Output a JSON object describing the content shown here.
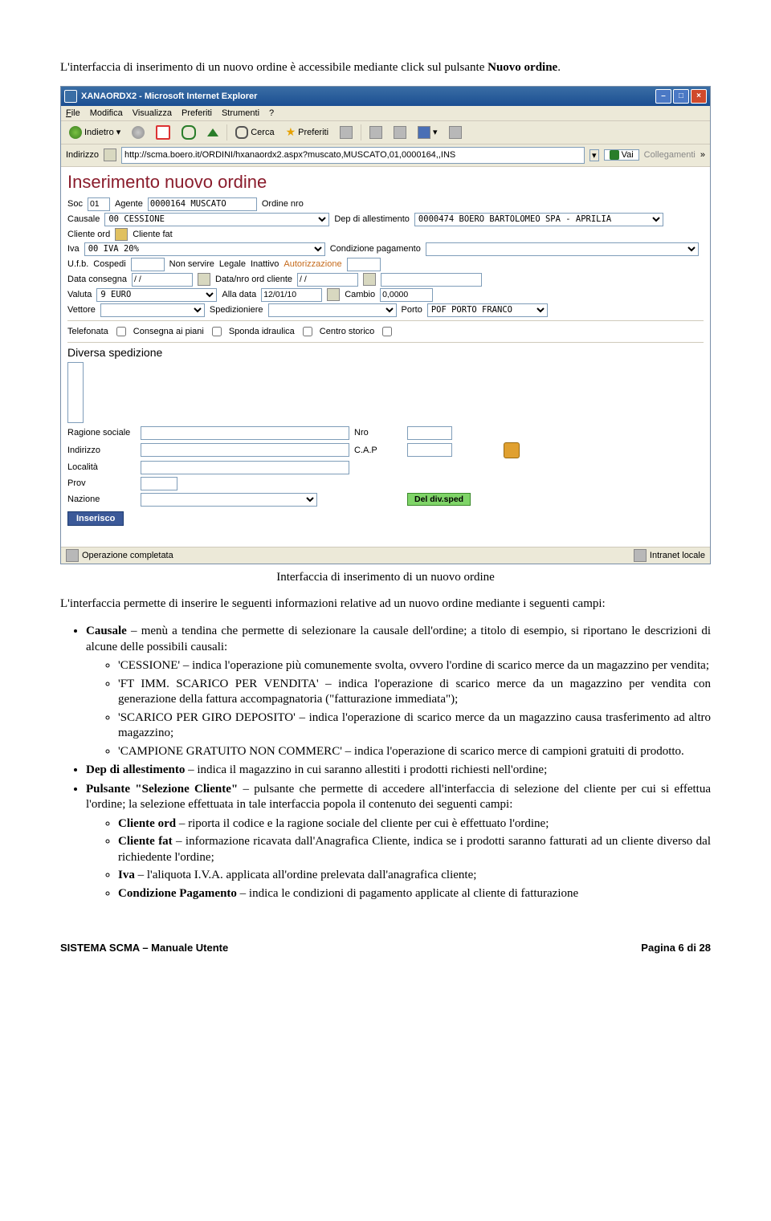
{
  "intro_prefix": "L'interfaccia di inserimento di un nuovo ordine è accessibile mediante click sul pulsante ",
  "intro_bold": "Nuovo ordine",
  "window": {
    "title": "XANAORDX2 - Microsoft Internet Explorer",
    "menu": {
      "file": "File",
      "mod": "Modifica",
      "vis": "Visualizza",
      "pref": "Preferiti",
      "str": "Strumenti",
      "help": "?"
    },
    "toolbar": {
      "back": "Indietro",
      "search": "Cerca",
      "fav": "Preferiti"
    },
    "addr_label": "Indirizzo",
    "addr_value": "http://scma.boero.it/ORDINI/hxanaordx2.aspx?muscato,MUSCATO,01,0000164,,INS",
    "go": "Vai",
    "links": "Collegamenti",
    "status_left": "Operazione completata",
    "status_right": "Intranet locale"
  },
  "form": {
    "title": "Inserimento nuovo ordine",
    "soc_l": "Soc",
    "soc_v": "01",
    "agente_l": "Agente",
    "agente_v": "0000164 MUSCATO",
    "ordine_l": "Ordine nro",
    "causale_l": "Causale",
    "causale_v": "00 CESSIONE",
    "dep_l": "Dep di allestimento",
    "dep_v": "0000474 BOERO BARTOLOMEO SPA - APRILIA",
    "cliord_l": "Cliente ord",
    "clifat_l": "Cliente fat",
    "iva_l": "Iva",
    "iva_v": "00 IVA 20%",
    "condpag_l": "Condizione pagamento",
    "ufb_l": "U.f.b.",
    "cosp_l": "Cospedi",
    "nonserv_l": "Non servire",
    "legale_l": "Legale",
    "inatt_l": "Inattivo",
    "auth_l": "Autorizzazione",
    "datacons_l": "Data consegna",
    "datacons_v": "/ /",
    "dataord_l": "Data/nro ord cliente",
    "dataord_v": "/ /",
    "valuta_l": "Valuta",
    "valuta_v": "9 EURO",
    "alladata_l": "Alla data",
    "alladata_v": "12/01/10",
    "cambio_l": "Cambio",
    "cambio_v": "0,0000",
    "vettore_l": "Vettore",
    "sped_l": "Spedizioniere",
    "porto_l": "Porto",
    "porto_v": "POF PORTO FRANCO",
    "tel_l": "Telefonata",
    "piani_l": "Consegna ai piani",
    "sponda_l": "Sponda idraulica",
    "centro_l": "Centro storico",
    "divsped": "Diversa spedizione",
    "rag_l": "Ragione sociale",
    "nro_l": "Nro",
    "ind_l": "Indirizzo",
    "cap_l": "C.A.P",
    "loc_l": "Località",
    "prov_l": "Prov",
    "naz_l": "Nazione",
    "del_btn": "Del div.sped",
    "ins_btn": "Inserisco"
  },
  "caption": "Interfaccia di inserimento di un nuovo ordine",
  "para2": "L'interfaccia permette di inserire le seguenti informazioni relative ad un nuovo ordine mediante i seguenti campi:",
  "b": {
    "causale_b": "Causale",
    "causale_t": " – menù a tendina che permette di selezionare la causale dell'ordine; a titolo di esempio, si riportano le descrizioni di alcune delle possibili causali:",
    "cess_q": "'CESSIONE'",
    "cess_t": " – indica l'operazione più comunemente svolta, ovvero l'ordine di scarico merce da un magazzino per vendita;",
    "ft_q": "'FT IMM. SCARICO PER VENDITA'",
    "ft_t": " – indica l'operazione di scarico merce da un magazzino per vendita con generazione della fattura accompagnatoria (\"fatturazione immediata\");",
    "giro_q": "'SCARICO PER GIRO DEPOSITO'",
    "giro_t": " – indica l'operazione di scarico merce da un magazzino causa trasferimento ad altro magazzino;",
    "camp_q": "'CAMPIONE GRATUITO NON COMMERC'",
    "camp_t": " – indica l'operazione di scarico merce di campioni gratuiti di prodotto.",
    "dep_b": "Dep di allestimento",
    "dep_t": " – indica il magazzino in cui saranno allestiti i prodotti richiesti nell'ordine;",
    "pul_b": "Pulsante \"Selezione Cliente\"",
    "pul_t": " – pulsante che permette di accedere all'interfaccia di selezione del cliente per cui si effettua l'ordine; la selezione effettuata in tale interfaccia popola il contenuto dei seguenti campi:",
    "cord_b": "Cliente ord",
    "cord_t": " – riporta il codice e la ragione sociale del cliente per cui è effettuato l'ordine;",
    "cfat_b": "Cliente fat",
    "cfat_t": " – informazione ricavata dall'Anagrafica Cliente, indica se i prodotti saranno fatturati ad un cliente diverso dal richiedente l'ordine;",
    "iva_b": "Iva",
    "iva_t": " – l'aliquota I.V.A. applicata all'ordine prelevata dall'anagrafica cliente;",
    "cond_b": "Condizione Pagamento",
    "cond_t": " – indica le condizioni di pagamento applicate al cliente di fatturazione"
  },
  "footer": {
    "left": "SISTEMA SCMA – Manuale Utente",
    "right": "Pagina 6 di 28"
  }
}
